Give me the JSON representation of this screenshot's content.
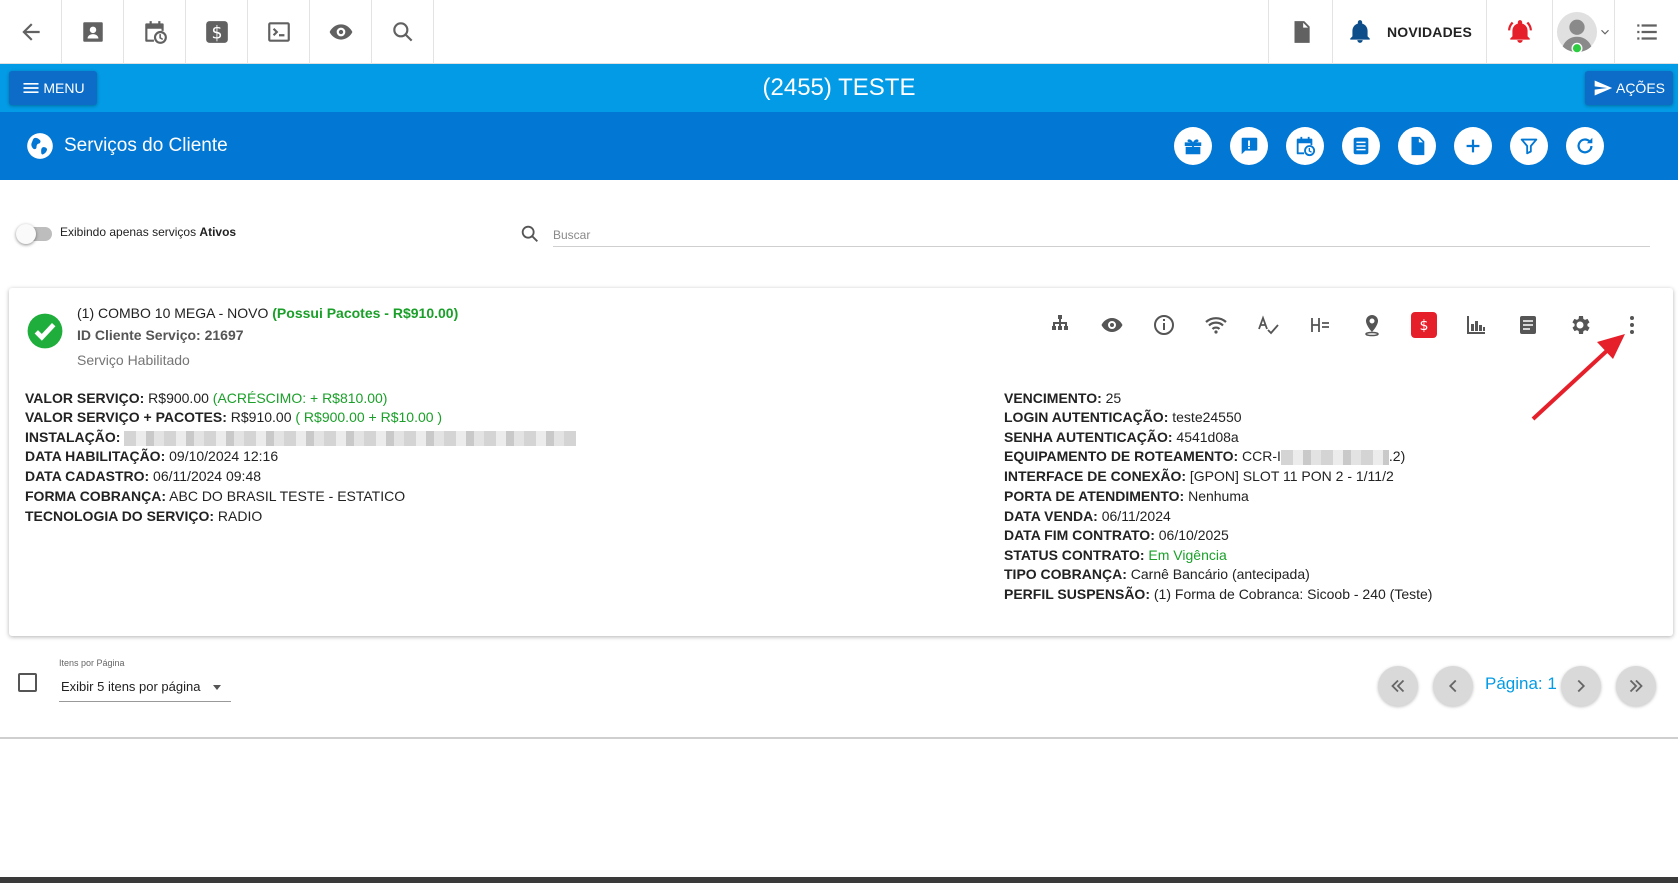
{
  "topbar": {
    "left_icons": [
      "back-arrow-icon",
      "contact-card-icon",
      "calendar-clock-icon",
      "dollar-icon",
      "terminal-icon",
      "eye-icon",
      "search-icon"
    ],
    "right": {
      "pdf_icon": "pdf-icon",
      "news_label": "NOVIDADES",
      "alert_icon": "alarm-icon",
      "avatar_status_color": "#2ecc40",
      "list_icon": "list-icon"
    }
  },
  "header": {
    "menu_label": "MENU",
    "title": "(2455) TESTE",
    "actions_label": "AÇÕES"
  },
  "section": {
    "title": "Serviços do Cliente",
    "buttons": [
      "gift-icon",
      "message-alert-icon",
      "calendar-clock-icon",
      "list-box-icon",
      "document-icon",
      "add-icon",
      "filter-icon",
      "refresh-icon"
    ]
  },
  "filter": {
    "toggle_text": "Exibindo apenas serviços ",
    "toggle_bold": "Ativos",
    "search_placeholder": "Buscar"
  },
  "service": {
    "title": "(1) COMBO 10 MEGA - NOVO",
    "packages": "(Possui Pacotes - R$910.00)",
    "client_service_id": "ID Cliente Serviço: 21697",
    "status": "Serviço Habilitado",
    "icons": [
      "network-tree-icon",
      "eye-icon",
      "info-icon",
      "wifi-icon",
      "spellcheck-icon",
      "heading-equal-icon",
      "map-pin-icon",
      "money-icon",
      "chart-bars-icon",
      "notes-icon",
      "gear-icon",
      "more-vertical-icon"
    ],
    "left_fields": [
      {
        "label": "VALOR SERVIÇO:",
        "value": " R$900.00 ",
        "extra": "(ACRÉSCIMO: + R$810.00)"
      },
      {
        "label": "VALOR SERVIÇO + PACOTES:",
        "value": " R$910.00 ",
        "extra": "( R$900.00 + R$10.00 )"
      },
      {
        "label": "INSTALAÇÃO:",
        "value": " ",
        "extra": ""
      },
      {
        "label": "DATA HABILITAÇÃO:",
        "value": " 09/10/2024 12:16",
        "extra": ""
      },
      {
        "label": "DATA CADASTRO:",
        "value": " 06/11/2024 09:48",
        "extra": ""
      },
      {
        "label": "FORMA COBRANÇA:",
        "value": " ABC DO BRASIL TESTE - ESTATICO",
        "extra": ""
      },
      {
        "label": "TECNOLOGIA DO SERVIÇO:",
        "value": " RADIO",
        "extra": ""
      }
    ],
    "right_fields": [
      {
        "label": "VENCIMENTO:",
        "value": " 25",
        "extra": ""
      },
      {
        "label": "LOGIN AUTENTICAÇÃO:",
        "value": " teste24550",
        "extra": ""
      },
      {
        "label": "SENHA AUTENTICAÇÃO:",
        "value": " 4541d08a",
        "extra": ""
      },
      {
        "label": "EQUIPAMENTO DE ROTEAMENTO:",
        "value": " CCR-I",
        "extra": ".2)"
      },
      {
        "label": "INTERFACE DE CONEXÃO:",
        "value": " [GPON] SLOT 11 PON 2 - 1/11/2",
        "extra": ""
      },
      {
        "label": "PORTA DE ATENDIMENTO:",
        "value": " Nenhuma",
        "extra": ""
      },
      {
        "label": "DATA VENDA:",
        "value": " 06/11/2024",
        "extra": ""
      },
      {
        "label": "DATA FIM CONTRATO:",
        "value": " 06/10/2025",
        "extra": ""
      },
      {
        "label": "STATUS CONTRATO:",
        "value": " ",
        "extra": "Em Vigência"
      },
      {
        "label": "TIPO COBRANÇA:",
        "value": " Carnê Bancário (antecipada)",
        "extra": ""
      },
      {
        "label": "PERFIL SUSPENSÃO:",
        "value": " (1) Forma de Cobranca: Sicoob - 240 (Teste)",
        "extra": ""
      }
    ]
  },
  "pagination": {
    "items_label": "Itens por Página",
    "items_value": "Exibir 5 itens por página",
    "page_label": "Página: 1"
  },
  "colors": {
    "accent": "#039be5",
    "header_dark": "#0277d3",
    "success": "#1a9f29",
    "alert": "#e5202b"
  }
}
